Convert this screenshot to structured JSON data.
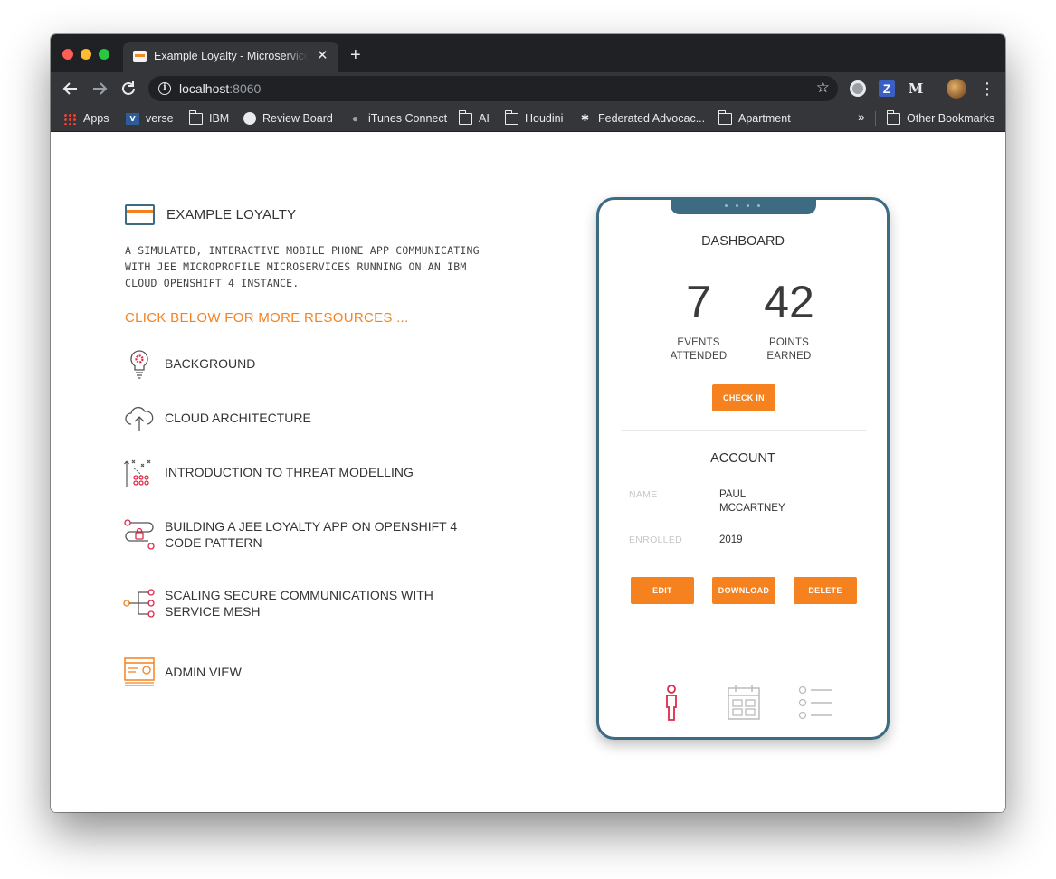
{
  "browser": {
    "tab_title": "Example Loyalty - Microservice E",
    "tab_close": "✕",
    "new_tab": "+",
    "url_host": "localhost",
    "url_port": ":8060",
    "bookmarks": [
      "Apps",
      "verse",
      "IBM",
      "Review Board",
      "iTunes Connect",
      "AI",
      "Houdini",
      "Federated Advocac...",
      "Apartment"
    ],
    "bookmarks_more": "»",
    "other_bookmarks": "Other Bookmarks",
    "extensions": {
      "zotero": "Z",
      "mendeley": "M"
    }
  },
  "page": {
    "brand_title": "EXAMPLE LOYALTY",
    "intro": "A SIMULATED, INTERACTIVE MOBILE PHONE APP COMMUNICATING WITH JEE MICROPROFILE MICROSERVICES RUNNING ON AN IBM CLOUD OPENSHIFT 4 INSTANCE.",
    "cta": "CLICK BELOW FOR MORE RESOURCES ...",
    "resources": [
      {
        "label": "BACKGROUND",
        "icon": "lightbulb-icon"
      },
      {
        "label": "CLOUD ARCHITECTURE",
        "icon": "cloud-upload-icon"
      },
      {
        "label": "INTRODUCTION TO THREAT MODELLING",
        "icon": "threat-model-icon"
      },
      {
        "label": "BUILDING A JEE LOYALTY APP ON OPENSHIFT 4 CODE PATTERN",
        "icon": "code-pattern-icon"
      },
      {
        "label": "SCALING SECURE COMMUNICATIONS WITH SERVICE MESH",
        "icon": "service-mesh-icon"
      },
      {
        "label": "ADMIN VIEW",
        "icon": "admin-window-icon"
      }
    ]
  },
  "phone": {
    "dashboard_title": "DASHBOARD",
    "events_value": "7",
    "events_label_1": "EVENTS",
    "events_label_2": "ATTENDED",
    "points_value": "42",
    "points_label_1": "POINTS",
    "points_label_2": "EARNED",
    "checkin_label": "CHECK IN",
    "account_title": "ACCOUNT",
    "name_key": "NAME",
    "name_value_1": "PAUL",
    "name_value_2": "MCCARTNEY",
    "enrolled_key": "ENROLLED",
    "enrolled_value": "2019",
    "edit_label": "EDIT",
    "download_label": "DOWNLOAD",
    "delete_label": "DELETE",
    "tabs": [
      "person-icon",
      "calendar-icon",
      "list-icon"
    ]
  },
  "colors": {
    "accent_orange": "#f5821f",
    "phone_frame": "#3d6b82",
    "active_tab_red": "#e0294a"
  }
}
